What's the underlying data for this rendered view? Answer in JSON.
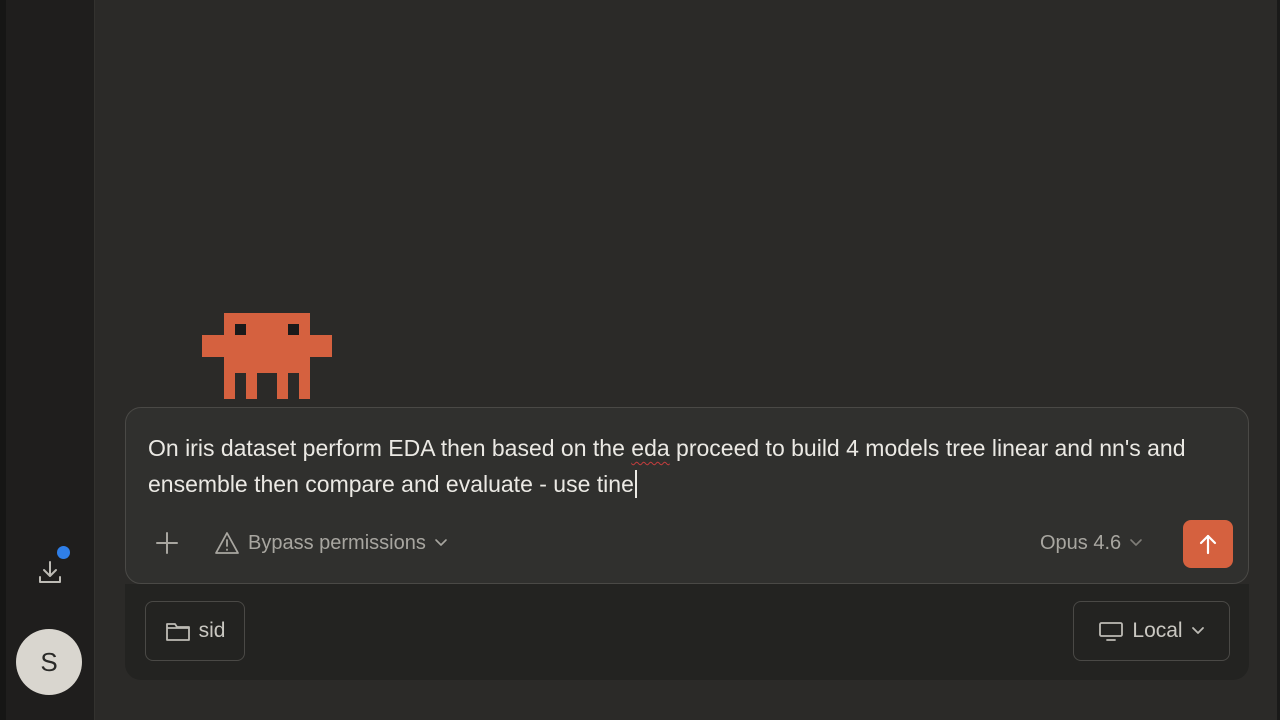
{
  "sidebar": {
    "download_icon": "download-icon",
    "notification_color": "#2f7fe8",
    "avatar_initial": "S"
  },
  "mascot": {
    "color": "#d5613f"
  },
  "composer": {
    "prompt_before": "On iris dataset perform EDA then based on the ",
    "prompt_misspelled": "eda",
    "prompt_after": " proceed to build 4 models tree linear and nn's and ensemble then compare and evaluate - use tine",
    "add_icon": "plus-icon",
    "permissions_label": "Bypass permissions",
    "permissions_icon": "warning-icon",
    "model_label": "Opus 4.6",
    "send_icon": "arrow-up-icon",
    "accent_color": "#d5613f"
  },
  "footer": {
    "folder_label": "sid",
    "folder_icon": "folder-icon",
    "environment_label": "Local",
    "environment_icon": "monitor-icon"
  }
}
